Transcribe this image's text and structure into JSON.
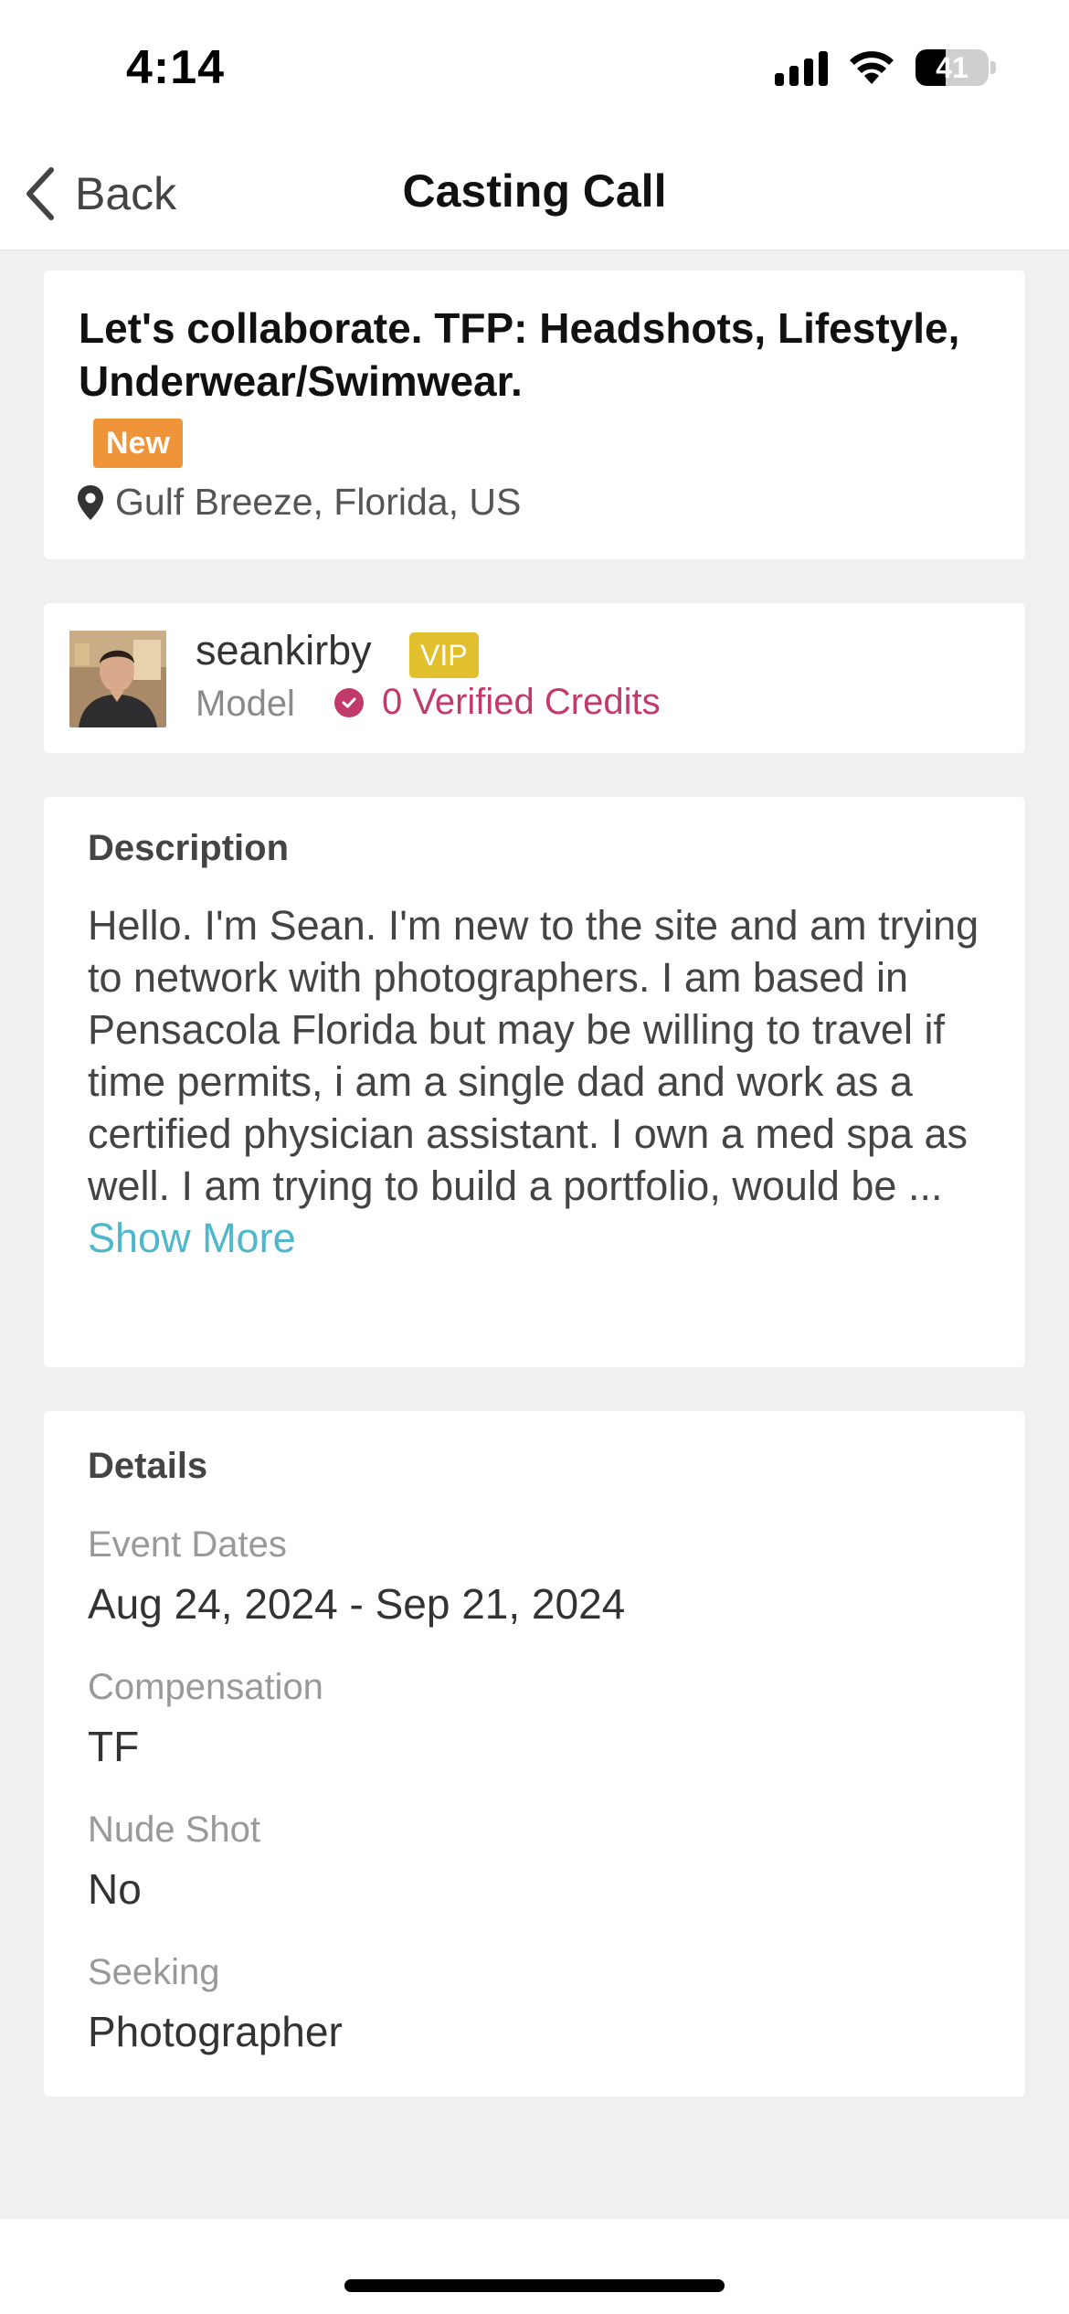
{
  "status_bar": {
    "time": "4:14",
    "battery": "41",
    "battery_level": 0.41,
    "icons": [
      "cellular-signal-icon",
      "wifi-icon",
      "battery-icon"
    ]
  },
  "nav": {
    "back_label": "Back",
    "title": "Casting Call"
  },
  "post": {
    "title": "Let's collaborate. TFP: Headshots, Lifestyle, Underwear/Swimwear.",
    "badge": "New",
    "location": "Gulf Breeze, Florida, US"
  },
  "author": {
    "username": "seankirby",
    "badge": "VIP",
    "role": "Model",
    "credits": "0 Verified Credits"
  },
  "description": {
    "heading": "Description",
    "text": "Hello. I'm Sean. I'm new to the site and am trying to network with photographers. I am based in Pensacola Florida but may be willing to travel if time permits, i am a single dad and work as a certified physician assistant. I own a med spa as well. I am trying to build a portfolio, would be ... ",
    "show_more": "Show More"
  },
  "details": {
    "heading": "Details",
    "items": [
      {
        "label": "Event Dates",
        "value": "Aug 24, 2024 - Sep 21, 2024"
      },
      {
        "label": "Compensation",
        "value": "TF"
      },
      {
        "label": "Nude Shot",
        "value": "No"
      },
      {
        "label": "Seeking",
        "value": "Photographer"
      }
    ]
  },
  "colors": {
    "new_badge": "#f0943a",
    "vip_badge": "#e2bf2c",
    "credits": "#c23a6b",
    "link": "#4eb7cc"
  }
}
